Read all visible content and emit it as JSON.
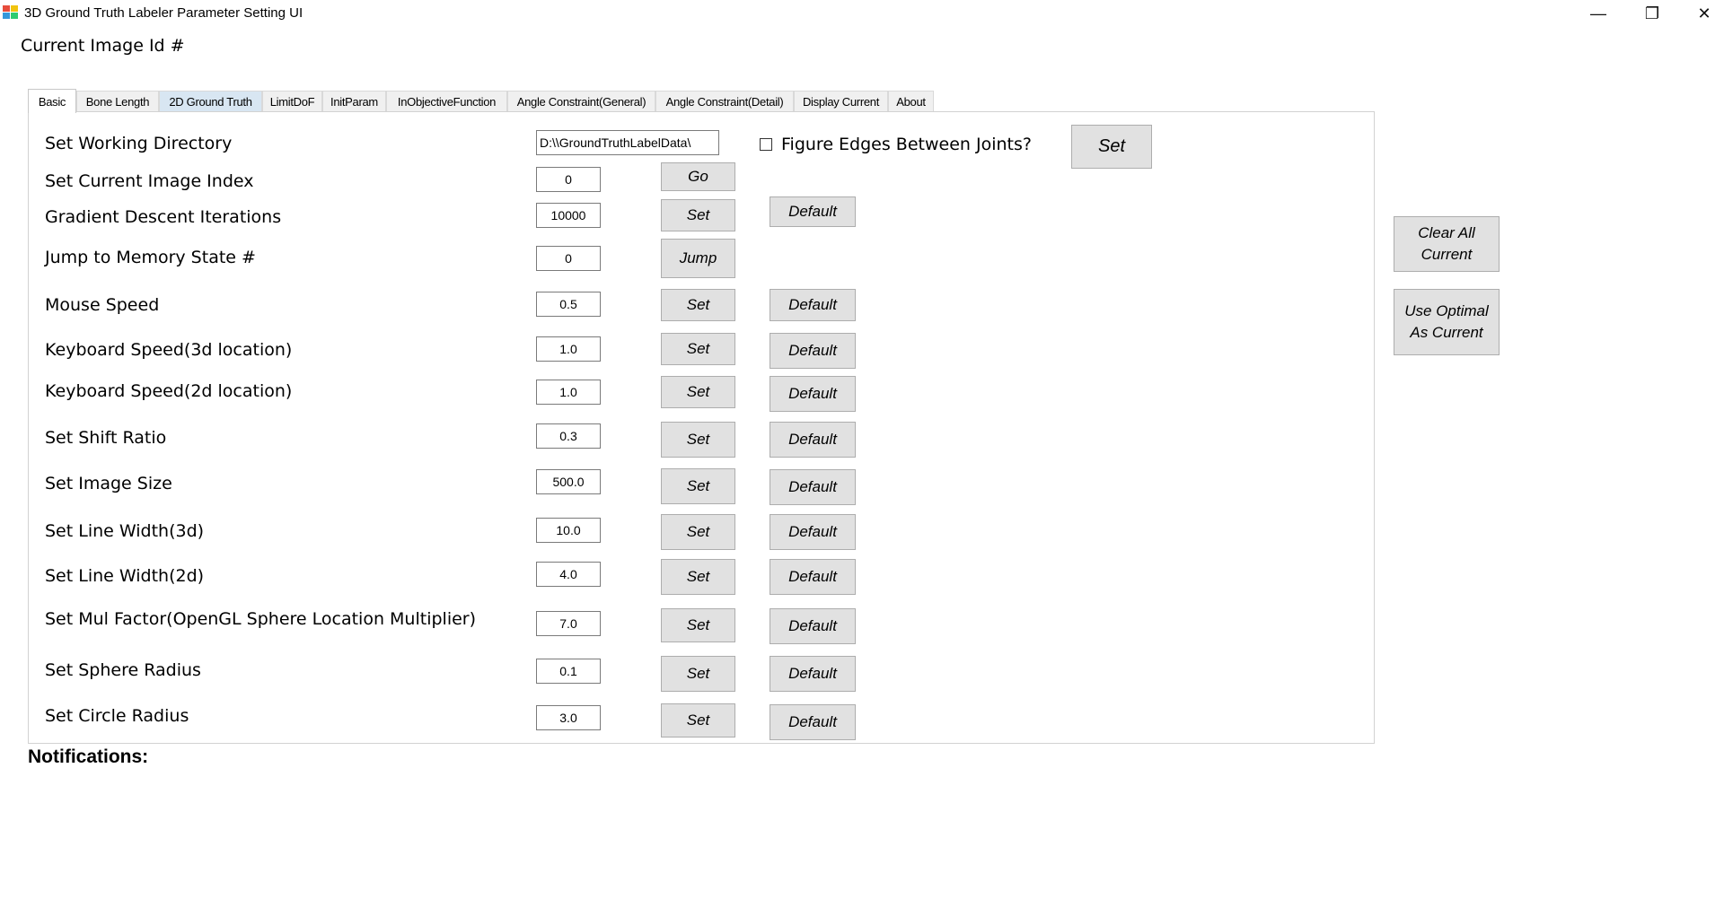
{
  "window": {
    "title": "3D Ground Truth Labeler Parameter Setting UI",
    "controls": {
      "minimize": "—",
      "maximize": "❐",
      "close": "✕"
    }
  },
  "current_image_label": "Current Image Id #",
  "tabs": [
    {
      "label": "Basic",
      "active": true
    },
    {
      "label": "Bone Length"
    },
    {
      "label": "2D Ground Truth",
      "hot": true
    },
    {
      "label": "LimitDoF"
    },
    {
      "label": "InitParam"
    },
    {
      "label": "InObjectiveFunction"
    },
    {
      "label": "Angle Constraint(General)"
    },
    {
      "label": "Angle Constraint(Detail)"
    },
    {
      "label": "Display Current"
    },
    {
      "label": "About"
    }
  ],
  "basic": {
    "working_dir": {
      "label": "Set Working Directory",
      "value": "D:\\\\GroundTruthLabelData\\"
    },
    "figure_edges": {
      "label": "Figure Edges Between Joints?",
      "checked": false,
      "button": "Set"
    },
    "image_index": {
      "label": "Set Current Image Index",
      "value": "0",
      "button": "Go"
    },
    "gd_iterations": {
      "label": "Gradient Descent Iterations",
      "value": "10000",
      "button": "Set",
      "default": "Default"
    },
    "memory_state": {
      "label": "Jump to Memory State #",
      "value": "0",
      "button": "Jump"
    },
    "mouse_speed": {
      "label": "Mouse Speed",
      "value": "0.5",
      "button": "Set",
      "default": "Default"
    },
    "kb_speed_3d": {
      "label": "Keyboard Speed(3d location)",
      "value": "1.0",
      "button": "Set",
      "default": "Default"
    },
    "kb_speed_2d": {
      "label": "Keyboard Speed(2d location)",
      "value": "1.0",
      "button": "Set",
      "default": "Default"
    },
    "shift_ratio": {
      "label": "Set Shift Ratio",
      "value": "0.3",
      "button": "Set",
      "default": "Default"
    },
    "image_size": {
      "label": "Set Image Size",
      "value": "500.0",
      "button": "Set",
      "default": "Default"
    },
    "line_width_3d": {
      "label": "Set Line Width(3d)",
      "value": "10.0",
      "button": "Set",
      "default": "Default"
    },
    "line_width_2d": {
      "label": "Set Line Width(2d)",
      "value": "4.0",
      "button": "Set",
      "default": "Default"
    },
    "mul_factor": {
      "label": "Set Mul Factor(OpenGL Sphere Location Multiplier)",
      "value": "7.0",
      "button": "Set",
      "default": "Default"
    },
    "sphere_radius": {
      "label": "Set Sphere Radius",
      "value": "0.1",
      "button": "Set",
      "default": "Default"
    },
    "circle_radius": {
      "label": "Set Circle Radius",
      "value": "3.0",
      "button": "Set",
      "default": "Default"
    }
  },
  "side_buttons": {
    "clear_all": "Clear All Current",
    "use_optimal": "Use Optimal As Current"
  },
  "notifications_label": "Notifications:"
}
